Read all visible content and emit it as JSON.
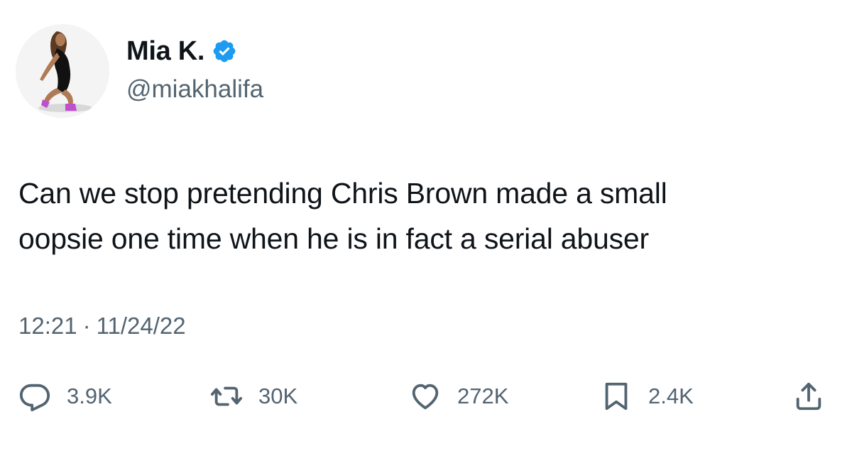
{
  "user": {
    "display_name": "Mia K.",
    "handle": "@miakhalifa",
    "verified_icon": "verified-badge-icon",
    "verified_color": "#1d9bf0"
  },
  "tweet": {
    "text": "Can we stop pretending Chris Brown made a small\noopsie one time when he is in fact a serial abuser",
    "time": "12:21",
    "separator": "·",
    "date": "11/24/22"
  },
  "actions": {
    "replies": "3.9K",
    "retweets": "30K",
    "likes": "272K",
    "bookmarks": "2.4K"
  },
  "colors": {
    "text": "#0f1419",
    "secondary": "#536471"
  }
}
